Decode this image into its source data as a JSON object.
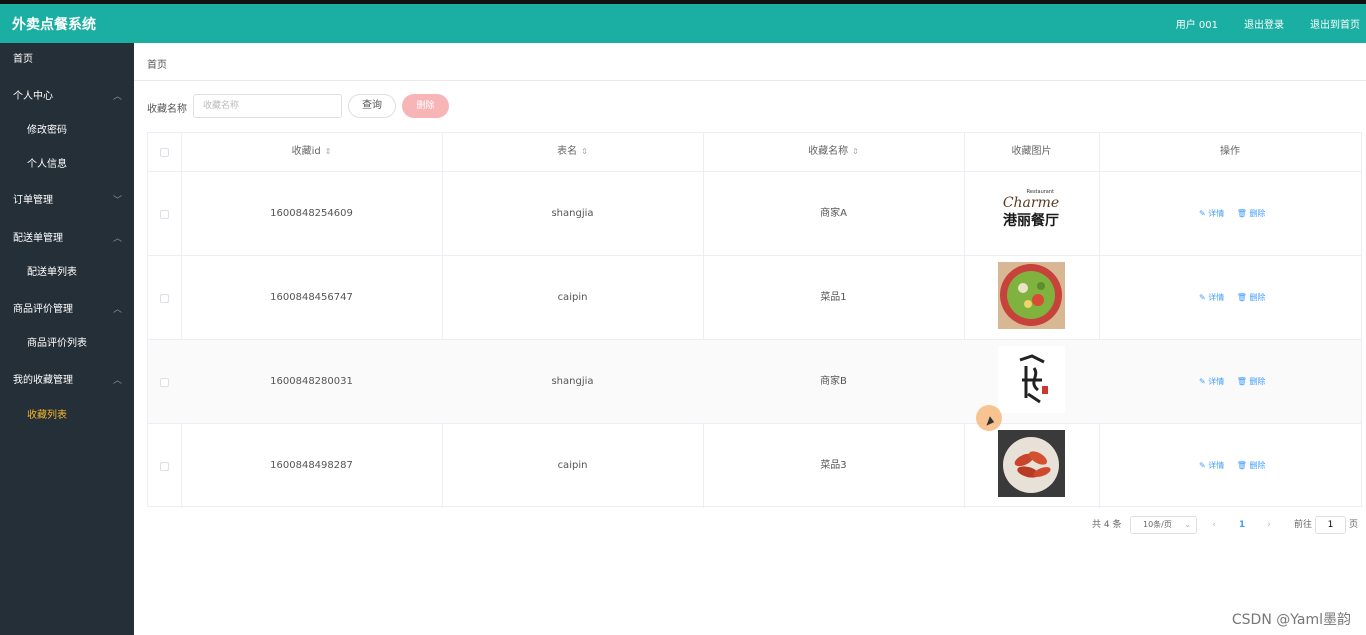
{
  "app": {
    "title": "外卖点餐系统",
    "header_links": [
      "用户 001",
      "退出登录",
      "退出到首页"
    ]
  },
  "sidebar": {
    "items": [
      {
        "label": "首页",
        "level": 1,
        "expandable": false
      },
      {
        "label": "个人中心",
        "level": 1,
        "expandable": true,
        "expanded": true
      },
      {
        "label": "修改密码",
        "level": 2
      },
      {
        "label": "个人信息",
        "level": 2
      },
      {
        "label": "订单管理",
        "level": 1,
        "expandable": true,
        "expanded": false
      },
      {
        "label": "配送单管理",
        "level": 1,
        "expandable": true,
        "expanded": true
      },
      {
        "label": "配送单列表",
        "level": 2
      },
      {
        "label": "商品评价管理",
        "level": 1,
        "expandable": true,
        "expanded": true
      },
      {
        "label": "商品评价列表",
        "level": 2
      },
      {
        "label": "我的收藏管理",
        "level": 1,
        "expandable": true,
        "expanded": true
      },
      {
        "label": "收藏列表",
        "level": 2,
        "active": true
      }
    ],
    "active_color": "#f5b52b"
  },
  "breadcrumb": "首页",
  "search": {
    "label": "收藏名称",
    "placeholder": "收藏名称",
    "value": "",
    "query_button": "查询",
    "delete_button": "删除"
  },
  "table": {
    "columns": [
      "收藏id",
      "表名",
      "收藏名称",
      "收藏图片",
      "操作"
    ],
    "sortable": [
      true,
      true,
      true,
      false,
      false
    ],
    "rows": [
      {
        "id": "1600848254609",
        "table_name": "shangjia",
        "name": "商家A",
        "image": "restaurant-logo-charme"
      },
      {
        "id": "1600848456747",
        "table_name": "caipin",
        "name": "菜品1",
        "image": "salad-bowl-photo"
      },
      {
        "id": "1600848280031",
        "table_name": "shangjia",
        "name": "商家B",
        "image": "calligraphy-logo"
      },
      {
        "id": "1600848498287",
        "table_name": "caipin",
        "name": "菜品3",
        "image": "crayfish-plate-photo"
      }
    ],
    "logo_text": {
      "top": "Restaurant",
      "brand": "Charme",
      "cn": "港丽餐厅"
    },
    "action_details": "详情",
    "action_delete": "删除"
  },
  "pagination": {
    "total": "共 4 条",
    "page_size": "10条/页",
    "current_page": "1",
    "goto_label": "前往",
    "goto_value": "1",
    "page_unit": "页"
  },
  "watermark": "CSDN @Yaml墨韵",
  "colors": {
    "header": "#1aafa2",
    "sidebar": "#252f37",
    "link": "#409eff",
    "delete_btn": "#f8b5b8"
  }
}
